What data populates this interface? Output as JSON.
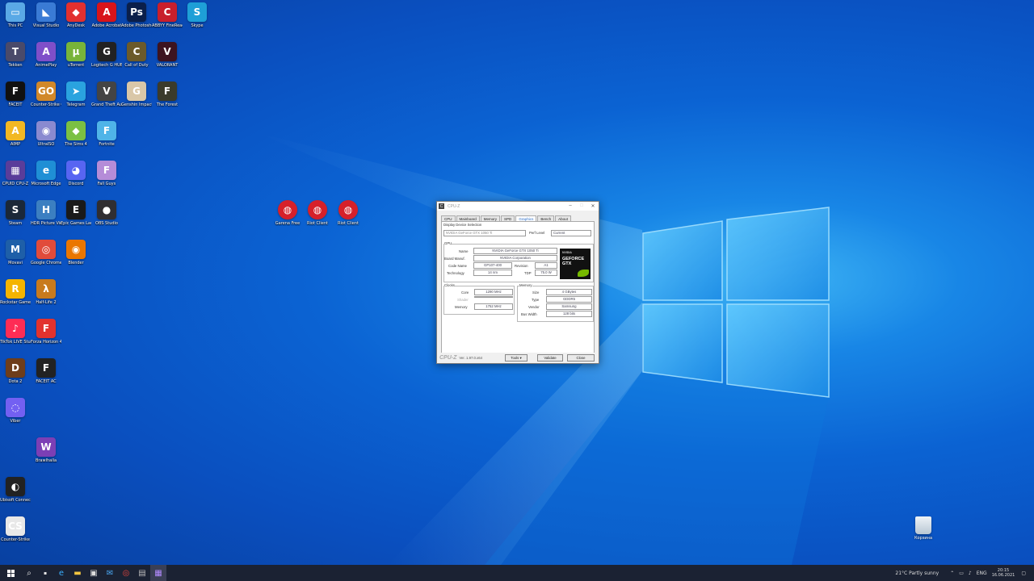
{
  "desktop_icons": [
    {
      "label": "This PC",
      "glyph": "▭",
      "color": "#5aa9e6"
    },
    {
      "label": "Visual Studio",
      "glyph": "◣",
      "color": "#3a7bd5"
    },
    {
      "label": "AnyDesk",
      "glyph": "◆",
      "color": "#e2302f"
    },
    {
      "label": "Adobe Acrobat",
      "glyph": "A",
      "color": "#d8141a"
    },
    {
      "label": "Adobe Photoshop",
      "glyph": "Ps",
      "color": "#0b1f4a"
    },
    {
      "label": "ABBYY FineReader",
      "glyph": "C",
      "color": "#c81f2c"
    },
    {
      "label": "Skype",
      "glyph": "S",
      "color": "#1e9fd7"
    },
    {
      "label": "Tekken",
      "glyph": "T",
      "color": "#4a4a6a"
    },
    {
      "label": "AnimePlay",
      "glyph": "A",
      "color": "#7f4fc9"
    },
    {
      "label": "uTorrent",
      "glyph": "µ",
      "color": "#78b43a"
    },
    {
      "label": "Logitech G HUB",
      "glyph": "G",
      "color": "#222222"
    },
    {
      "label": "Call of Duty",
      "glyph": "C",
      "color": "#6b5a2a"
    },
    {
      "label": "VALORANT",
      "glyph": "V",
      "color": "#3d1420"
    },
    {
      "label": "FACEIT",
      "glyph": "F",
      "color": "#111111"
    },
    {
      "label": "Counter-Strike Global Offensive",
      "glyph": "GO",
      "color": "#d1882a"
    },
    {
      "label": "Telegram",
      "glyph": "➤",
      "color": "#2aa3df"
    },
    {
      "label": "Grand Theft Auto V",
      "glyph": "V",
      "color": "#444444"
    },
    {
      "label": "Genshin Impact",
      "glyph": "G",
      "color": "#d9c7a8"
    },
    {
      "label": "The Forest",
      "glyph": "F",
      "color": "#3b3b2b"
    },
    {
      "label": "AIMP",
      "glyph": "A",
      "color": "#f2b823"
    },
    {
      "label": "UltraISO",
      "glyph": "◉",
      "color": "#8a8ad0"
    },
    {
      "label": "The Sims 4",
      "glyph": "◆",
      "color": "#7bc043"
    },
    {
      "label": "Fortnite",
      "glyph": "F",
      "color": "#4fb4e8"
    },
    {
      "label": "CPUID CPU-Z",
      "glyph": "▦",
      "color": "#5a3d9a"
    },
    {
      "label": "Microsoft Edge",
      "glyph": "e",
      "color": "#1f8fd5"
    },
    {
      "label": "Discord",
      "glyph": "◕",
      "color": "#5865f2"
    },
    {
      "label": "Fall Guys",
      "glyph": "F",
      "color": "#b58cd8"
    },
    {
      "label": "Steam",
      "glyph": "S",
      "color": "#1b2838"
    },
    {
      "label": "HDR Picture Viewer",
      "glyph": "H",
      "color": "#3c7fc1"
    },
    {
      "label": "Epic Games Launcher",
      "glyph": "E",
      "color": "#1a1a1a"
    },
    {
      "label": "OBS Studio",
      "glyph": "●",
      "color": "#302e31"
    },
    {
      "label": "Movavi",
      "glyph": "M",
      "color": "#1e5fa8"
    },
    {
      "label": "Google Chrome",
      "glyph": "◎",
      "color": "#e14b3b"
    },
    {
      "label": "Blender",
      "glyph": "◉",
      "color": "#ea7600"
    },
    {
      "label": "Rockstar Games Launcher",
      "glyph": "R",
      "color": "#f4b400"
    },
    {
      "label": "Half-Life 2",
      "glyph": "λ",
      "color": "#c87a1d"
    },
    {
      "label": "TikTok LIVE Studio",
      "glyph": "♪",
      "color": "#fe2c55"
    },
    {
      "label": "Forza Horizon 4",
      "glyph": "F",
      "color": "#e2322e"
    },
    {
      "label": "Dota 2",
      "glyph": "D",
      "color": "#6e3d1a"
    },
    {
      "label": "FACEIT AC",
      "glyph": "F",
      "color": "#222222"
    },
    {
      "label": "Viber",
      "glyph": "◌",
      "color": "#7360f2"
    },
    {
      "label": "Brawlhalla",
      "glyph": "W",
      "color": "#7c3fb5"
    },
    {
      "label": "Ubisoft Connect",
      "glyph": "◐",
      "color": "#222222"
    },
    {
      "label": "Counter-Strike",
      "glyph": "CS",
      "color": "#e8e8e8"
    },
    {
      "label": "Garena Free",
      "glyph": "◍",
      "color": "#d6202a"
    },
    {
      "label": "Riot Client",
      "glyph": "◍",
      "color": "#d6202a"
    },
    {
      "label": "Riot Client",
      "glyph": "◍",
      "color": "#d6202a"
    }
  ],
  "recycle_bin": {
    "label": "Корзина",
    "glyph": "🗑"
  },
  "cpuz": {
    "title": "CPU-Z",
    "tabs": [
      "CPU",
      "Mainboard",
      "Memory",
      "SPD",
      "Graphics",
      "Bench",
      "About"
    ],
    "active_tab": "Graphics",
    "display_selection_label": "Display Device Selection",
    "device": "NVIDIA GeForce GTX 1050 Ti",
    "perf_level_label": "Perf Level",
    "perf_level": "Current",
    "gpu_group": "GPU",
    "name_label": "Name",
    "name": "NVIDIA GeForce GTX 1050 Ti",
    "board_label": "Board Manuf.",
    "board": "NVIDIA Corporation",
    "codename_label": "Code Name",
    "codename": "GP107-400",
    "revision_label": "Revision",
    "revision": "A1",
    "tech_label": "Technology",
    "tech": "14 nm",
    "tdp_label": "TDP",
    "tdp": "75.0 W",
    "logo_text": "GEFORCE GTX",
    "logo_brand": "NVIDIA",
    "clocks_group": "Clocks",
    "core_label": "Core",
    "core": "1290 MHz",
    "shader_label": "Shader",
    "shader": "",
    "memory_clk_label": "Memory",
    "memory_clk": "1752 MHz",
    "memory_group": "Memory",
    "size_label": "Size",
    "size": "4 GBytes",
    "type_label": "Type",
    "type": "GDDR5",
    "vendor_label": "Vendor",
    "vendor": "Samsung",
    "buswidth_label": "Bus Width",
    "buswidth": "128 bits",
    "brand": "CPU-Z",
    "version": "Ver. 1.97.0.x64",
    "tools_btn": "Tools",
    "validate_btn": "Validate",
    "close_btn": "Close"
  },
  "taskbar": {
    "weather": "21°C  Partly sunny",
    "lang": "ENG",
    "time": "20:15",
    "date": "16.06.2021"
  }
}
